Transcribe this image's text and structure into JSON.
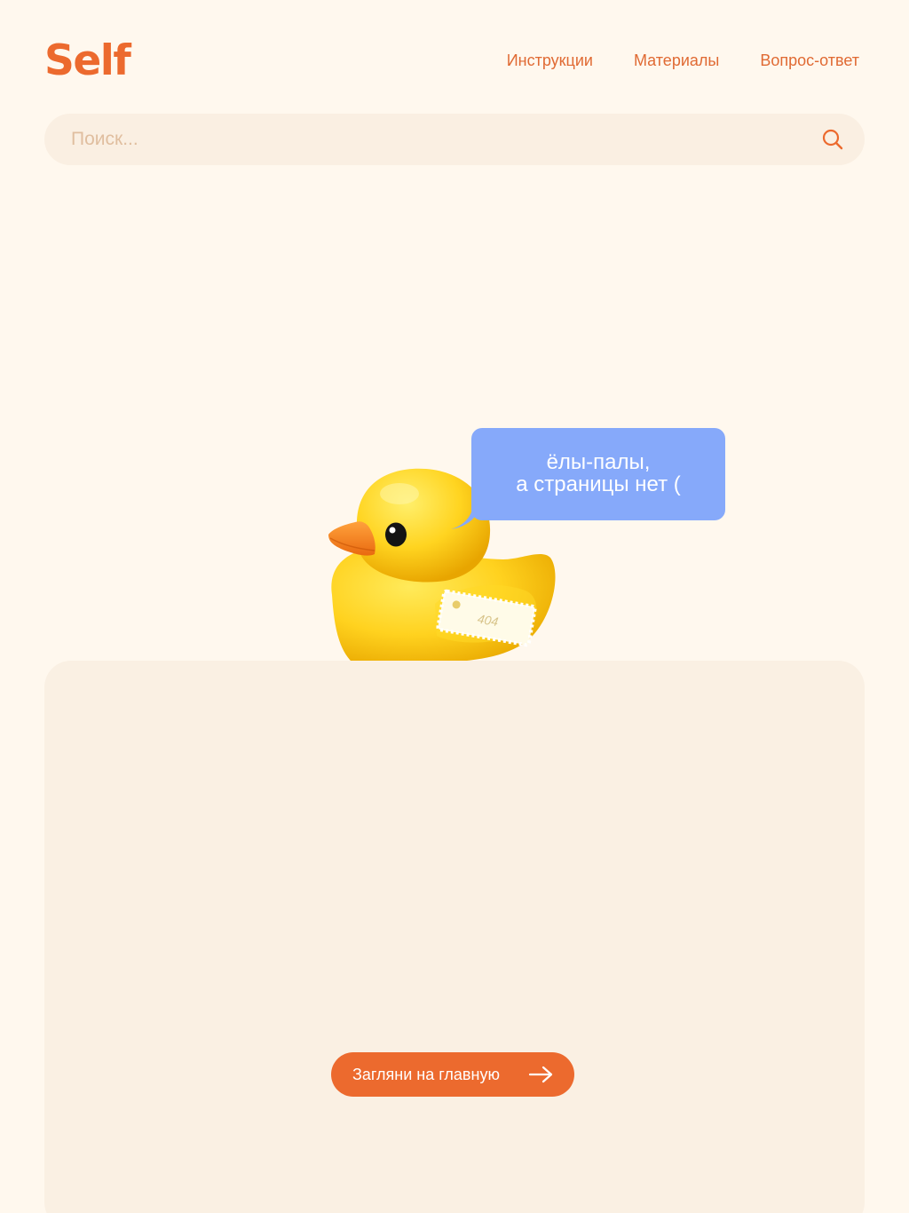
{
  "header": {
    "logo": "Self",
    "nav": [
      {
        "label": "Инструкции"
      },
      {
        "label": "Материалы"
      },
      {
        "label": "Вопрос-ответ"
      }
    ]
  },
  "search": {
    "placeholder": "Поиск...",
    "value": "",
    "icon": "search-icon"
  },
  "error": {
    "bubble_line1": "ёлы-палы,",
    "bubble_line2": "а страницы нет (",
    "tag_text": "404"
  },
  "cta": {
    "label": "Загляни на главную",
    "icon": "arrow-right-icon"
  },
  "colors": {
    "background": "#FFF8EE",
    "accent": "#EC6A2E",
    "bubble": "#86A9FA",
    "panel": "#FAF0E3",
    "duck": "#FFD21F"
  }
}
